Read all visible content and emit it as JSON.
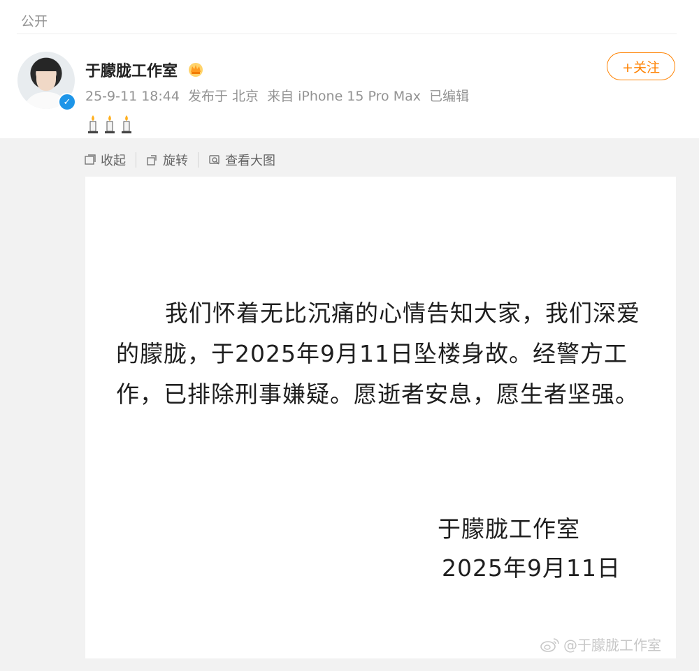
{
  "post": {
    "visibility": "公开",
    "author": {
      "name": "于朦胧工作室",
      "verified": true
    },
    "meta": {
      "time": "25-9-11 18:44",
      "location": "发布于 北京",
      "source": "来自 iPhone 15 Pro Max",
      "edited": "已编辑"
    },
    "follow_label": "+关注",
    "icons": [
      "crown-icon",
      "verified-icon",
      "candle-icon"
    ]
  },
  "toolbar": {
    "collapse": "收起",
    "rotate": "旋转",
    "view_large": "查看大图"
  },
  "image": {
    "statement": "我们怀着无比沉痛的心情告知大家，我们深爱的朦胧，于2025年9月11日坠楼身故。经警方工作，已排除刑事嫌疑。愿逝者安息，愿生者坚强。",
    "signature_name": "于朦胧工作室",
    "signature_date": "2025年9月11日",
    "watermark": "@于朦胧工作室"
  },
  "colors": {
    "accent": "#ff8200",
    "verified": "#1d95e8",
    "muted_text": "#939393"
  }
}
